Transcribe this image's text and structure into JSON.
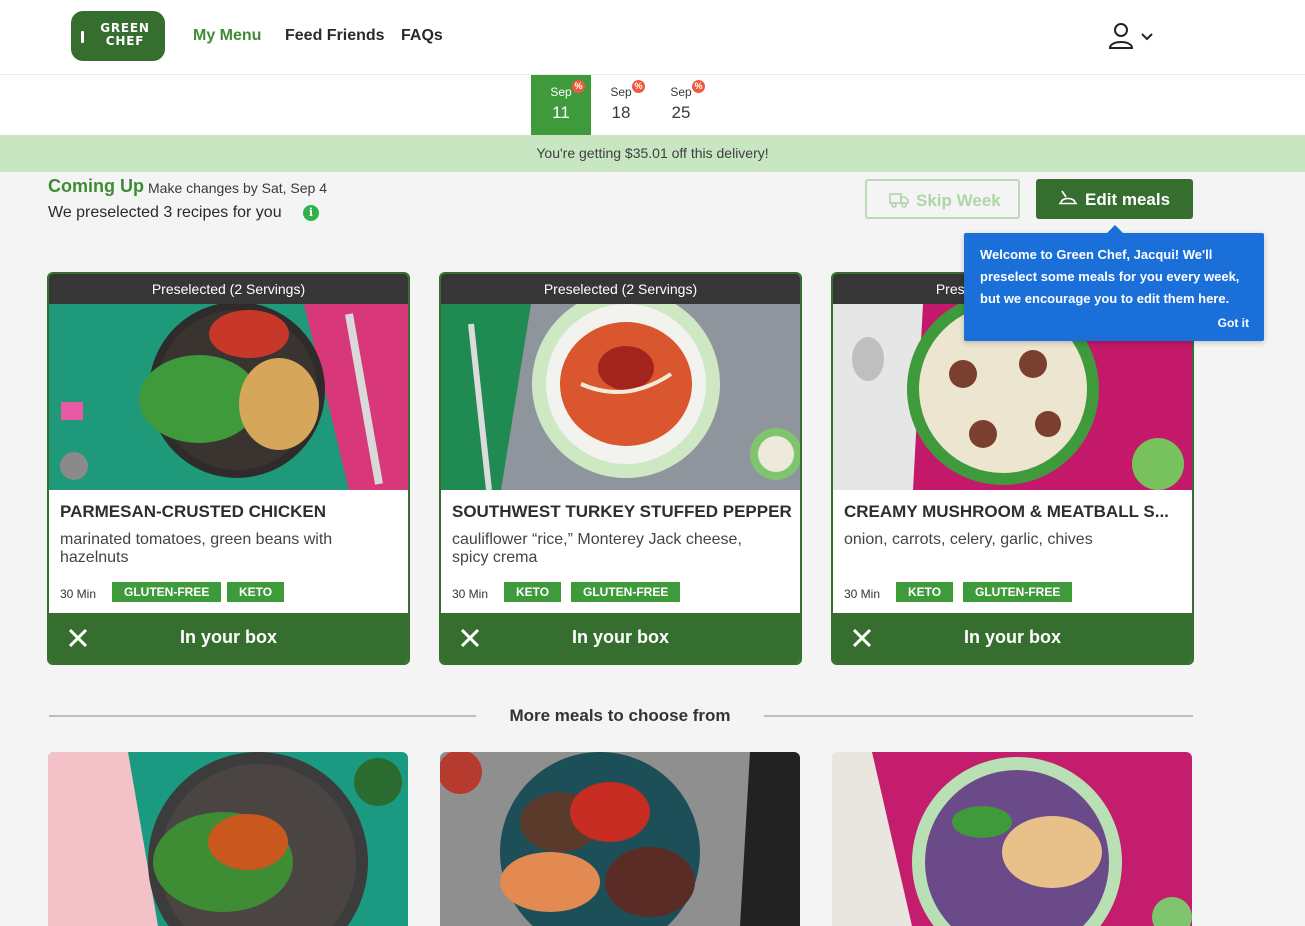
{
  "header": {
    "logo_text": "GREEN CHEF",
    "nav": [
      {
        "label": "My Menu",
        "active": true
      },
      {
        "label": "Feed Friends",
        "active": false
      },
      {
        "label": "FAQs",
        "active": false
      }
    ]
  },
  "weeks": [
    {
      "month": "Sep",
      "day": "11",
      "active": true,
      "badge": "%"
    },
    {
      "month": "Sep",
      "day": "18",
      "active": false,
      "badge": "%"
    },
    {
      "month": "Sep",
      "day": "25",
      "active": false,
      "badge": "%"
    }
  ],
  "promo": "You're getting $35.01 off this delivery!",
  "coming_up": {
    "title": "Coming Up",
    "deadline": "Make changes by Sat, Sep 4",
    "preselected": "We preselected 3 recipes for you",
    "info_icon": "i"
  },
  "actions": {
    "skip_label": "Skip Week",
    "edit_label": "Edit meals"
  },
  "tooltip": {
    "message": "Welcome to Green Chef, Jacqui! We'll preselect some meals for you every week, but we encourage you to edit them here.",
    "button": "Got it"
  },
  "cards": [
    {
      "ribbon": "Preselected (2 Servings)",
      "title": "PARMESAN-CRUSTED CHICKEN",
      "desc": "marinated tomatoes, green beans with hazelnuts",
      "time": "30 Min",
      "tags": [
        "GLUTEN-FREE",
        "KETO"
      ],
      "box_label": "In your box"
    },
    {
      "ribbon": "Preselected (2 Servings)",
      "title": "SOUTHWEST TURKEY STUFFED PEPPERS",
      "desc": "cauliflower “rice,” Monterey Jack cheese, spicy crema",
      "time": "30 Min",
      "tags": [
        "KETO",
        "GLUTEN-FREE"
      ],
      "box_label": "In your box"
    },
    {
      "ribbon": "Preselected (2 Servings)",
      "title": "CREAMY MUSHROOM & MEATBALL S...",
      "desc": "onion, carrots, celery, garlic, chives",
      "time": "30 Min",
      "tags": [
        "KETO",
        "GLUTEN-FREE"
      ],
      "box_label": "In your box"
    }
  ],
  "more_meals_label": "More meals to choose from",
  "colors": {
    "brand_green": "#356e2f",
    "accent_green": "#3f9a3c",
    "promo_bg": "#c9e6c2",
    "tooltip_blue": "#1b6fd9"
  },
  "icons": {
    "user": "user-icon",
    "chevron": "chevron-down-icon",
    "skip": "truck-icon",
    "edit": "cloche-icon",
    "remove": "close-icon",
    "info": "info-icon"
  }
}
